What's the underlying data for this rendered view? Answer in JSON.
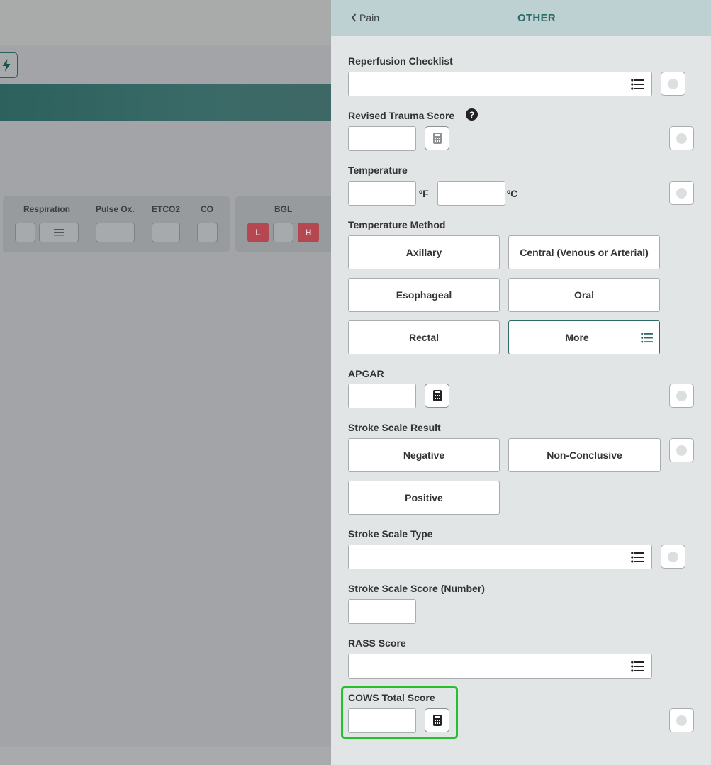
{
  "background": {
    "vitals": {
      "labels": [
        "Respiration",
        "Pulse Ox.",
        "ETCO2",
        "CO"
      ]
    },
    "bgl": {
      "label": "BGL",
      "low": "L",
      "high": "H"
    }
  },
  "panel": {
    "back_label": "Pain",
    "title": "OTHER",
    "reperfusion": {
      "label": "Reperfusion Checklist",
      "value": ""
    },
    "trauma": {
      "label": "Revised Trauma Score",
      "help": "?",
      "value": ""
    },
    "temperature": {
      "label": "Temperature",
      "fahrenheit_unit": "ºF",
      "celsius_unit": "ºC",
      "value_f": "",
      "value_c": ""
    },
    "temp_method": {
      "label": "Temperature Method",
      "options": [
        "Axillary",
        "Central (Venous or Arterial)",
        "Esophageal",
        "Oral",
        "Rectal",
        "More"
      ]
    },
    "apgar": {
      "label": "APGAR",
      "value": ""
    },
    "stroke_result": {
      "label": "Stroke Scale Result",
      "options": [
        "Negative",
        "Non-Conclusive",
        "Positive"
      ]
    },
    "stroke_type": {
      "label": "Stroke Scale Type",
      "value": ""
    },
    "stroke_score": {
      "label": "Stroke Scale Score (Number)",
      "value": ""
    },
    "rass": {
      "label": "RASS Score",
      "value": ""
    },
    "cows": {
      "label": "COWS Total Score",
      "value": ""
    }
  },
  "colors": {
    "panel_header": "#bdd1d3",
    "title_teal": "#2d6b68",
    "highlight_green": "#25c02a",
    "bgl_red": "#b4474f"
  },
  "icons": {
    "back": "chevron-left-icon",
    "list": "list-icon",
    "calculator": "calculator-icon",
    "help": "question-circle-icon",
    "bolt": "lightning-bolt-icon",
    "menu": "hamburger-icon"
  }
}
